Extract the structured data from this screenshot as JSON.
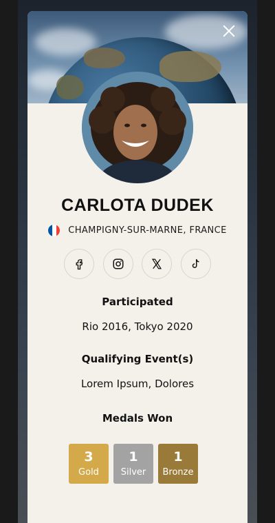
{
  "profile": {
    "name": "CARLOTA DUDEK",
    "location": "CHAMPIGNY-SUR-MARNE, FRANCE",
    "flag_colors": [
      "#0055A4",
      "#FFFFFF",
      "#EF4135"
    ]
  },
  "socials": [
    {
      "icon": "facebook-icon"
    },
    {
      "icon": "instagram-icon"
    },
    {
      "icon": "x-icon"
    },
    {
      "icon": "tiktok-icon"
    }
  ],
  "sections": {
    "participated": {
      "heading": "Participated",
      "value": "Rio 2016, Tokyo 2020"
    },
    "qualifying": {
      "heading": "Qualifying Event(s)",
      "value": "Lorem Ipsum, Dolores"
    },
    "medals_heading": "Medals Won"
  },
  "medals": [
    {
      "count": "3",
      "label": "Gold",
      "color": "#d4a94a"
    },
    {
      "count": "1",
      "label": "Silver",
      "color": "#a3a3a3"
    },
    {
      "count": "1",
      "label": "Bronze",
      "color": "#9a7a38"
    }
  ]
}
